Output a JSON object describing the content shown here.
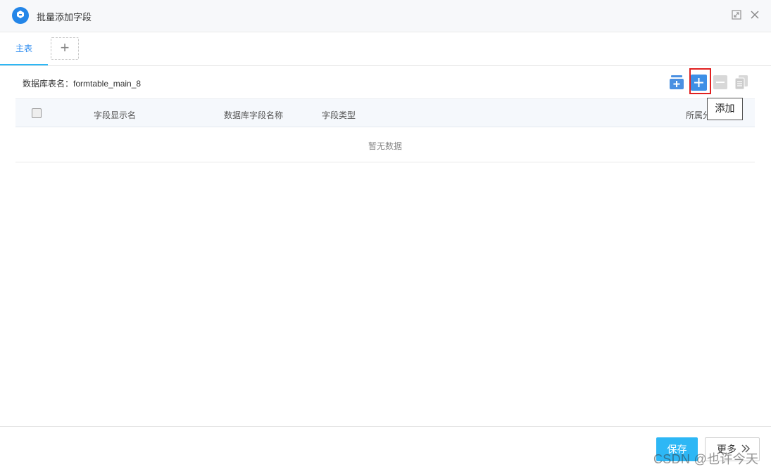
{
  "window": {
    "title": "批量添加字段",
    "icons": {
      "logo": "app-logo-icon",
      "maximize": "maximize-icon",
      "close": "close-icon"
    }
  },
  "tabs": {
    "main_label": "主表",
    "add_label": "+"
  },
  "table_info": {
    "label": "数据库表名：formtable_main_8"
  },
  "toolbar": {
    "icons": [
      "batch-add-icon",
      "plus-icon",
      "minus-icon",
      "copy-icon"
    ],
    "tooltip": "添加"
  },
  "table": {
    "columns": [
      "字段显示名",
      "数据库字段名称",
      "字段类型",
      "所属分"
    ],
    "empty_text": "暂无数据"
  },
  "footer": {
    "save_label": "保存",
    "more_label": "更多",
    "more_icon": "double-chevron-right-icon",
    "watermark": "CSDN @也许今天"
  },
  "colors": {
    "accent": "#2db7f5",
    "link": "#2d8cf0",
    "highlight": "#e02020",
    "logo": "#2486e8"
  }
}
